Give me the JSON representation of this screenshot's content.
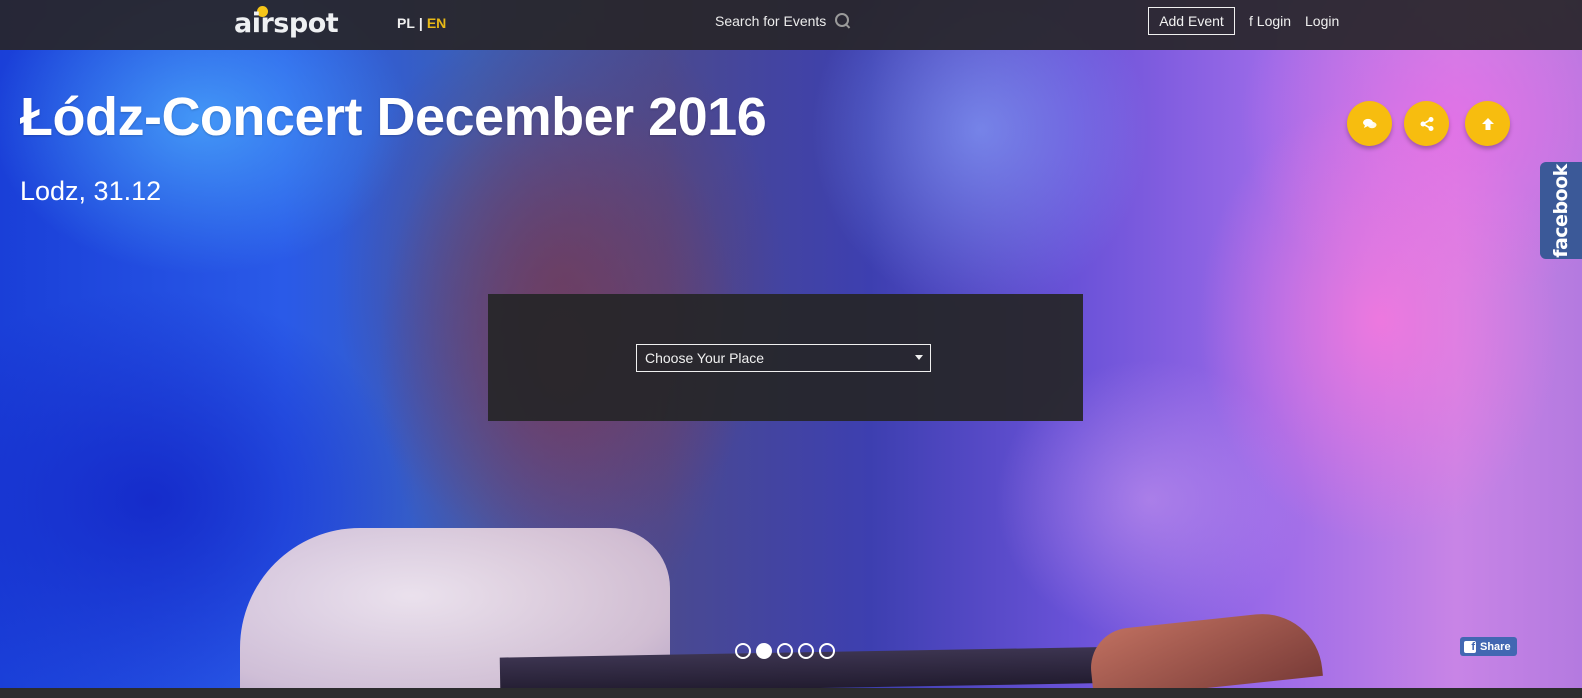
{
  "navbar": {
    "logo": "airspot",
    "languages": [
      {
        "code": "PL",
        "active": false
      },
      {
        "code": "EN",
        "active": true
      }
    ],
    "language_separator": "|",
    "search_label": "Search for Events",
    "search_icon": "search-icon",
    "add_event_label": "Add Event",
    "fb_login_label": "f Login",
    "login_label": "Login"
  },
  "event": {
    "title": "Łódz-Concert December 2016",
    "subtitle": "Lodz, 31.12"
  },
  "actions": [
    {
      "name": "comments",
      "icon": "comments-icon"
    },
    {
      "name": "share",
      "icon": "share-icon"
    },
    {
      "name": "scroll-up",
      "icon": "arrow-up-icon"
    }
  ],
  "facebook_tab": {
    "label": "facebook"
  },
  "place_select": {
    "selected": "Choose Your Place"
  },
  "carousel": {
    "slide_count": 5,
    "active_index": 1
  },
  "facebook_share": {
    "label": "Share"
  },
  "colors": {
    "accent_yellow": "#f7bd0f",
    "lang_active": "#e8b916",
    "facebook_blue": "#3b5998",
    "navbar_bg": "#28262a"
  }
}
